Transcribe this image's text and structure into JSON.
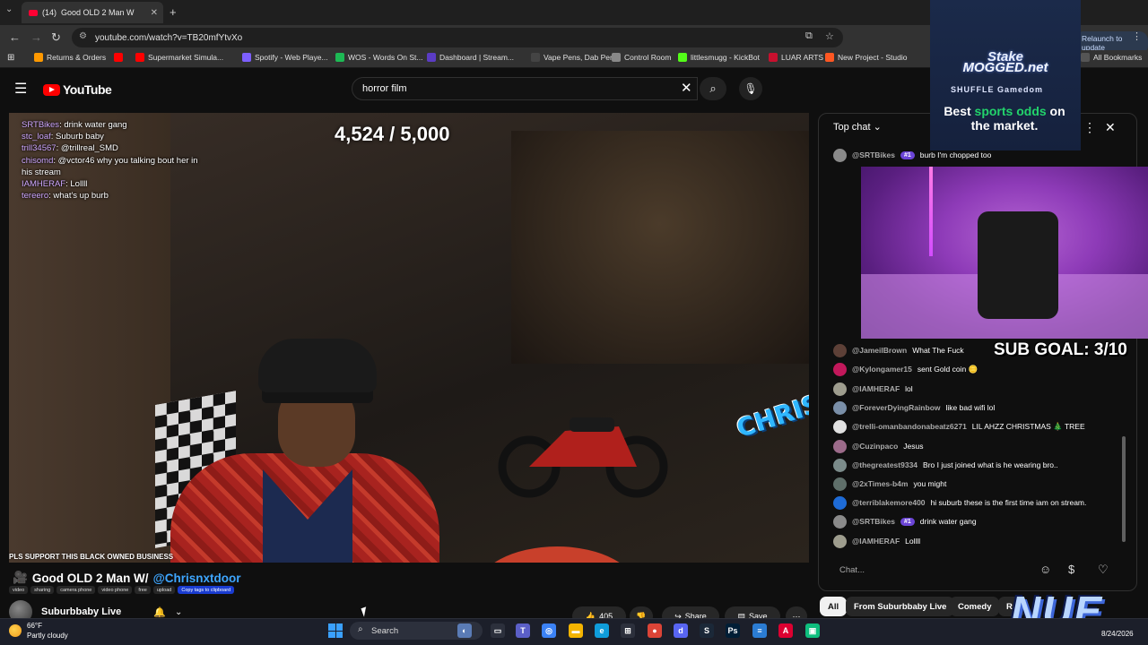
{
  "browser": {
    "tab_count": "(14)",
    "tab_title": "Good OLD 2 Man W",
    "url": "youtube.com/watch?v=TB20mfYtvXo",
    "relaunch_label": "Relaunch to update",
    "bookmarks": [
      {
        "label": "Returns & Orders",
        "color": "#ff9900"
      },
      {
        "label": "",
        "color": "#ff0000"
      },
      {
        "label": "Supermarket Simula...",
        "color": "#ff0000"
      },
      {
        "label": "Spotify - Web Playe...",
        "color": "#7d5fff"
      },
      {
        "label": "WOS - Words On St...",
        "color": "#1db954"
      },
      {
        "label": "Dashboard | Stream...",
        "color": "#5b3cc4"
      },
      {
        "label": "Vape Pens, Dab Pen...",
        "color": "#444"
      },
      {
        "label": "Control Room",
        "color": "#888"
      },
      {
        "label": "littlesmugg - KickBot",
        "color": "#53fc18"
      },
      {
        "label": "LUAR ARTS",
        "color": "#c8102e"
      },
      {
        "label": "New Project - Studio",
        "color": "#ff5722"
      },
      {
        "label": "All Bookmarks",
        "color": "#555"
      }
    ]
  },
  "masthead": {
    "logo_text": "YouTube",
    "search_value": "horror film"
  },
  "video": {
    "stream_goal": "4,524 / 5,000",
    "support_text": "PLS SUPPORT THIS BLACK OWNED BUSINESS",
    "overlay_chat": [
      {
        "user": "SRTBikes",
        "text": ": drink water gang"
      },
      {
        "user": "stc_loaf",
        "text": ": Suburb baby"
      },
      {
        "user": "trill34567",
        "text": ": @trillreal_SMD"
      },
      {
        "user": "chisomd",
        "text": ": @vctor46 why you talking bout her in his stream"
      },
      {
        "user": "IAMHERAF",
        "text": ": Lollll"
      },
      {
        "user": "tereero",
        "text": ": what's up burb"
      }
    ]
  },
  "video_info": {
    "title_prefix": "Good OLD 2 Man W/ ",
    "title_mention": "@Chrisnxtdoor",
    "tags": [
      "video",
      "sharing",
      "camera phone",
      "video phone",
      "free",
      "upload"
    ],
    "copy_tags_label": "Copy tags to clipboard",
    "channel_name": "Suburbbaby Live",
    "like_count": "405",
    "share_label": "Share",
    "save_label": "Save"
  },
  "chat": {
    "header": "Top chat",
    "input_placeholder": "Chat...",
    "messages": [
      {
        "author": "@SRTBikes",
        "badge": "#1",
        "text": "burb I'm chopped too",
        "color": "#8a8a8a"
      },
      {
        "author": "@JameilBrown",
        "badge": "",
        "text": "What The Fuck",
        "color": "#5d4037"
      },
      {
        "author": "@Kylongamer15",
        "badge": "",
        "text": "sent Gold coin 🪙",
        "color": "#c2185b"
      },
      {
        "author": "@IAMHERAF",
        "badge": "",
        "text": "lol",
        "color": "#9e9d8e"
      },
      {
        "author": "@ForeverDyingRainbow",
        "badge": "",
        "text": "like bad wifi lol",
        "color": "#7a8fa8"
      },
      {
        "author": "@trelli-omanbandonabeatz6271",
        "badge": "",
        "text": "LIL AHZZ CHRISTMAS 🎄 TREE",
        "color": "#e0e0e0"
      },
      {
        "author": "@Cuzinpaco",
        "badge": "",
        "text": "Jesus",
        "color": "#9c6b8a"
      },
      {
        "author": "@thegreatest9334",
        "badge": "",
        "text": "Bro I just joined what is he wearing bro..",
        "color": "#7b8b8a"
      },
      {
        "author": "@2xTimes-b4m",
        "badge": "",
        "text": "you might",
        "color": "#5f6f6a"
      },
      {
        "author": "@terriblakemore400",
        "badge": "",
        "text": "hi suburb these is the first time iam on stream.",
        "color": "#1e6bd6"
      },
      {
        "author": "@SRTBikes",
        "badge": "#1",
        "text": "drink water gang",
        "color": "#8a8a8a"
      },
      {
        "author": "@IAMHERAF",
        "badge": "",
        "text": "Lollll",
        "color": "#9e9d8e"
      }
    ]
  },
  "chips": [
    "All",
    "From Suburbbaby Live",
    "Comedy",
    "Ra"
  ],
  "overlays": {
    "ad_brand_top": "Stake",
    "ad_brand_mid": "MOGGED.net",
    "ad_brand_bottom": "SHUFFLE  Gamedom",
    "ad_headline_1": "Best ",
    "ad_headline_green": "sports odds",
    "ad_headline_2": " on the market.",
    "sub_goal": "SUB GOAL: 3/10",
    "nue_logo": "NUE"
  },
  "taskbar": {
    "temperature": "66°F",
    "condition": "Partly cloudy",
    "search_label": "Search",
    "date": "8/24/2026"
  }
}
